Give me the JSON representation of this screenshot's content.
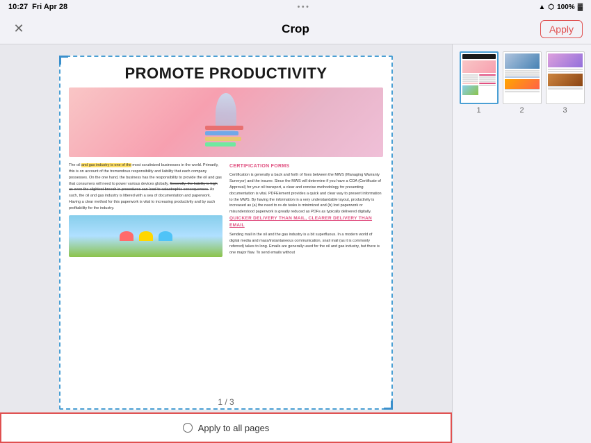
{
  "statusBar": {
    "time": "10:27",
    "date": "Fri Apr 28",
    "dots": "•  •  •",
    "wifi": "WiFi",
    "bluetooth": "BT",
    "battery": "100%",
    "batteryIcon": "🔋"
  },
  "toolbar": {
    "title": "Crop",
    "closeLabel": "✕",
    "applyLabel": "Apply"
  },
  "document": {
    "title": "PROMOTE PRODUCTIVITY",
    "pageIndicator": "1 / 3",
    "col1": {
      "bodyText": "The oil and gas industry is one of the most scrutinized businesses in the world. Primarily, this is on account of the tremendous responsibility and liability that each company possesses. On the one hand, the business has the responsibility to provide the oil and gas that consumers will need to power various devices globally. Secondly, the liability is high as even the slightest breech in procedures can lead to catastrophic consequences. As such, the oil and gas industry is littered with a sea of documentation and paperwork. Having a clear method for this paperwork is vital to increasing productivity and by such profitability for the industry."
    },
    "col2": {
      "heading1": "CERTIFICATION FORMS",
      "text1": "Certification is generally a back and forth of fixes between the MWS (Managing Warranty Surveyor) and the insurer. Since the MWS will determine if you have a COA (Certificate of Approval) for your oil transport, a clear and concise methodology for presenting documentation is vital. PDFElement provides a quick and clear way to present information to the MWS. By having the information in a very understandable layout, productivity is increased as (a) the need to re-do tasks is minimized and (b) lost paperwork or misunderstood paperwork is greatly reduced as PDFs as typically delivered digitally.",
      "heading2": "QUICKER DELIVERY THAN MAIL, CLEARER DELIVERY THAN EMAIL",
      "text2": "Sending mail in the oil and the gas industry is a bit superfluous. In a modern world of digital media and mass/instantaneous communication, snail mail (as it is commonly referred) takes to long. Emails are generally used for the oil and gas industry, but there is one major flaw. To send emails without"
    }
  },
  "applyAllBar": {
    "circleIcon": "○",
    "label": "Apply to all pages"
  },
  "thumbnails": [
    {
      "label": "1",
      "selected": true
    },
    {
      "label": "2",
      "selected": false
    },
    {
      "label": "3",
      "selected": false
    }
  ]
}
